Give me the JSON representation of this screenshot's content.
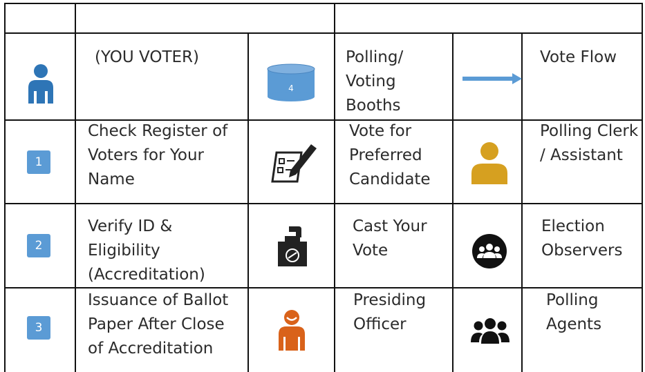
{
  "legend": {
    "items": [
      {
        "label_lines": [
          "(YOU VOTER)"
        ],
        "icon": "voter-icon",
        "color": "#2e75b6"
      },
      {
        "label_lines": [
          "Polling/",
          "Voting",
          "Booths"
        ],
        "icon": "polling-booth-icon",
        "badge": "4",
        "color": "#5b9bd5"
      },
      {
        "label_lines": [
          "Vote Flow"
        ],
        "icon": "vote-flow-arrow-icon",
        "color": "#5b9bd5"
      },
      {
        "label_lines": [
          "Check Register of",
          "Voters for Your",
          "Name"
        ],
        "icon": "step-1-badge",
        "badge": "1",
        "color": "#5b9bd5"
      },
      {
        "label_lines": [
          "Vote for",
          "Preferred",
          "Candidate"
        ],
        "icon": "ballot-marking-icon"
      },
      {
        "label_lines": [
          "Polling Clerk",
          "/ Assistant"
        ],
        "icon": "polling-clerk-icon",
        "color": "#d6a020"
      },
      {
        "label_lines": [
          "Verify ID &",
          "Eligibility",
          "(Accreditation)"
        ],
        "icon": "step-2-badge",
        "badge": "2",
        "color": "#5b9bd5"
      },
      {
        "label_lines": [
          "Cast Your",
          "Vote"
        ],
        "icon": "ballot-box-icon"
      },
      {
        "label_lines": [
          "Election",
          "Observers"
        ],
        "icon": "observers-icon"
      },
      {
        "label_lines": [
          "Issuance of Ballot",
          "Paper After Close",
          "of Accreditation"
        ],
        "icon": "step-3-badge",
        "badge": "3",
        "color": "#5b9bd5"
      },
      {
        "label_lines": [
          "Presiding",
          "Officer"
        ],
        "icon": "presiding-officer-icon",
        "color": "#d9621a"
      },
      {
        "label_lines": [
          "Polling",
          "Agents"
        ],
        "icon": "polling-agents-icon"
      }
    ]
  }
}
